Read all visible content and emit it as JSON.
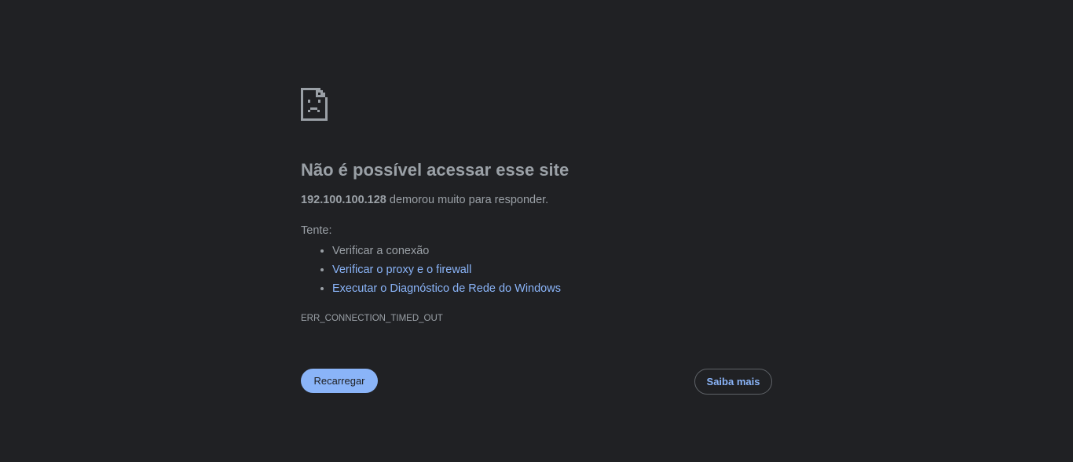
{
  "page": {
    "icon": "sad-file-icon",
    "title": "Não é possível acessar esse site",
    "summary": {
      "host": "192.100.100.128",
      "message": " demorou muito para responder."
    },
    "try_label": "Tente:",
    "suggestions": [
      {
        "label": "Verificar a conexão",
        "is_link": false
      },
      {
        "label": "Verificar o proxy e o firewall",
        "is_link": true
      },
      {
        "label": "Executar o Diagnóstico de Rede do Windows",
        "is_link": true
      }
    ],
    "error_code": "ERR_CONNECTION_TIMED_OUT",
    "buttons": {
      "reload": "Recarregar",
      "learn_more": "Saiba mais"
    }
  },
  "colors": {
    "background": "#202124",
    "text": "#9aa0a6",
    "link": "#8ab4f8",
    "primary_button": "#8ab4f8",
    "secondary_border": "#5f6368"
  }
}
